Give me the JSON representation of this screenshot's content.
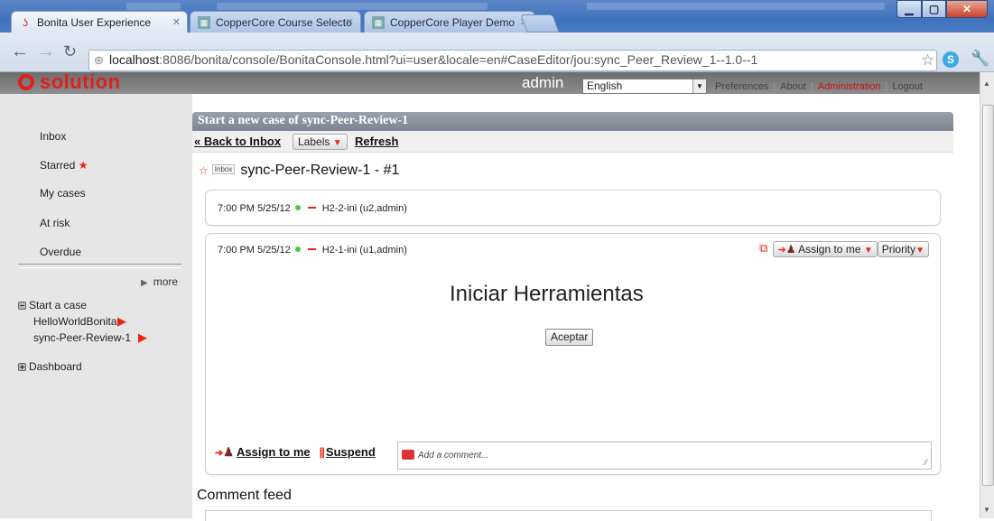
{
  "browser": {
    "tabs": [
      {
        "label": "Bonita User Experience",
        "active": true
      },
      {
        "label": "CopperCore Course Selecto",
        "active": false
      },
      {
        "label": "CopperCore Player Demo",
        "active": false
      }
    ],
    "url_host": "localhost",
    "url_rest": ":8086/bonita/console/BonitaConsole.html?ui=user&locale=en#CaseEditor/jou:sync_Peer_Review_1--1.0--1"
  },
  "header": {
    "logo_text": "solution",
    "username": "admin",
    "language": "English",
    "links": [
      "Preferences",
      "About",
      "Administration",
      "Logout"
    ]
  },
  "sidebar": {
    "items": [
      "Inbox",
      "Starred",
      "My cases",
      "At risk",
      "Overdue"
    ],
    "more": "more",
    "start_case": "Start a case",
    "processes": [
      "HelloWorldBonita",
      "sync-Peer-Review-1"
    ],
    "dashboard": "Dashboard"
  },
  "main": {
    "header_title": "Start a new case of sync-Peer-Review-1",
    "toolbar": {
      "back": "« Back to Inbox",
      "labels": "Labels",
      "refresh": "Refresh"
    },
    "case_badge": "Inbox",
    "case_title": "sync-Peer-Review-1 - #1",
    "steps": [
      {
        "time": "7:00 PM 5/25/12",
        "name": "H2-2-ini (u2,admin)"
      },
      {
        "time": "7:00 PM 5/25/12",
        "name": "H2-1-ini (u1,admin)"
      }
    ],
    "step_tools": {
      "assign": "Assign to me",
      "priority": "Priority"
    },
    "form_title": "Iniciar Herramientas",
    "form_button": "Aceptar",
    "footer": {
      "assign": "Assign to me",
      "suspend": "Suspend",
      "comment_placeholder": "Add a comment..."
    },
    "comment_feed": "Comment feed"
  },
  "colors": {
    "accent_red": "#e0201c",
    "header_gray": "#7c848f",
    "sidebar_bg": "#e6e6e6"
  }
}
